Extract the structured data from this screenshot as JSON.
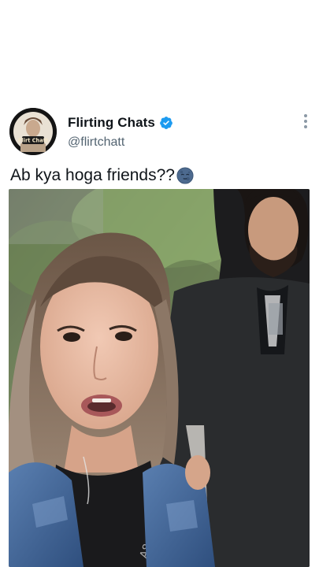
{
  "account": {
    "display_name": "Flirting Chats",
    "handle": "@flirtchatt",
    "verified": true,
    "avatar_text": "Flirt Chatt",
    "verified_color": "#1d9bf0"
  },
  "post": {
    "text": "Ab kya hoga friends??",
    "emoji": "moon-face-emoji",
    "media_type": "video-frame"
  },
  "icons": {
    "more": "more-vertical-icon",
    "verified": "verified-badge-icon"
  },
  "colors": {
    "text_primary": "#0f1419",
    "text_secondary": "#536471",
    "accent": "#1d9bf0"
  }
}
